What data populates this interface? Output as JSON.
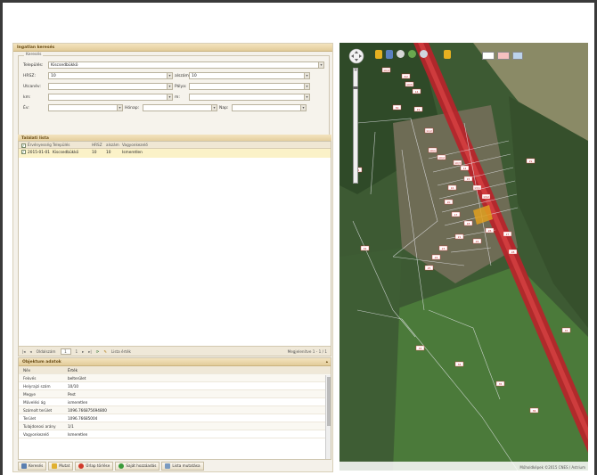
{
  "search_panel": {
    "title": "Ingatlan keresés",
    "legend": "Keresés",
    "telepules_label": "Település:",
    "telepules_value": "Kiscsedbükkö",
    "hrsz_label": "HRSZ:",
    "hrsz_value": "10",
    "alszam_label": "alszám:",
    "alszam_value": "10",
    "utca_label": "Utcanév:",
    "palya_label": "Pálya:",
    "km_label": "km:",
    "m_label": "m:",
    "ev_label": "Év:",
    "honap_label": "Hónap:",
    "nap_label": "Nap:"
  },
  "result_list": {
    "title": "Találati lista",
    "columns": [
      "",
      "Érvényesség",
      "Település",
      "HRSZ",
      "alszám",
      "Vagyonkezelő"
    ],
    "rows": [
      {
        "date": "2015-01-01",
        "town": "Kiscsedbükkö",
        "hrsz": "10",
        "alszam": "10",
        "manager": "Ismeretlen"
      }
    ]
  },
  "pager": {
    "prev_label": "Oldalszám",
    "page": "1",
    "of": "1",
    "export_label": "Lista érték",
    "summary": "Megjelenítve 1 - 1 / 1"
  },
  "attributes": {
    "title": "Objektum adatok",
    "col_name": "Név",
    "col_value": "Érték",
    "rows": [
      {
        "name": "Fekvés",
        "value": "belterület"
      },
      {
        "name": "Helyrajzi szám",
        "value": "10/10"
      },
      {
        "name": "Megye",
        "value": "Pest"
      },
      {
        "name": "Művelési ág",
        "value": "ismeretlen"
      },
      {
        "name": "Számolt terület",
        "value": "1096.766875694800"
      },
      {
        "name": "Terület",
        "value": "1096.76685004"
      },
      {
        "name": "Tulajdonosi arány",
        "value": "1/1"
      },
      {
        "name": "Vagyonkezelő",
        "value": "Ismeretlen"
      }
    ]
  },
  "toolbar": {
    "search": "Keresés",
    "show": "Mutat",
    "clear": "Űrlap törlése",
    "own": "Saját hozzáadás",
    "list": "Lista mutatása"
  },
  "map": {
    "credit": "Műholdképek ©2015 CNES / Astrium",
    "road_color": "#c0262b",
    "labels": [
      "10/4",
      "3/2",
      "10/5",
      "14",
      "19",
      "11/2",
      "10/1",
      "10/2",
      "10/3",
      "12",
      "15",
      "13/1",
      "13/2",
      "16",
      "20",
      "17",
      "18",
      "21",
      "22",
      "23",
      "24",
      "25",
      "26",
      "27",
      "28",
      "29",
      "30",
      "31",
      "32",
      "33",
      "34",
      "35",
      "36",
      "37"
    ]
  }
}
